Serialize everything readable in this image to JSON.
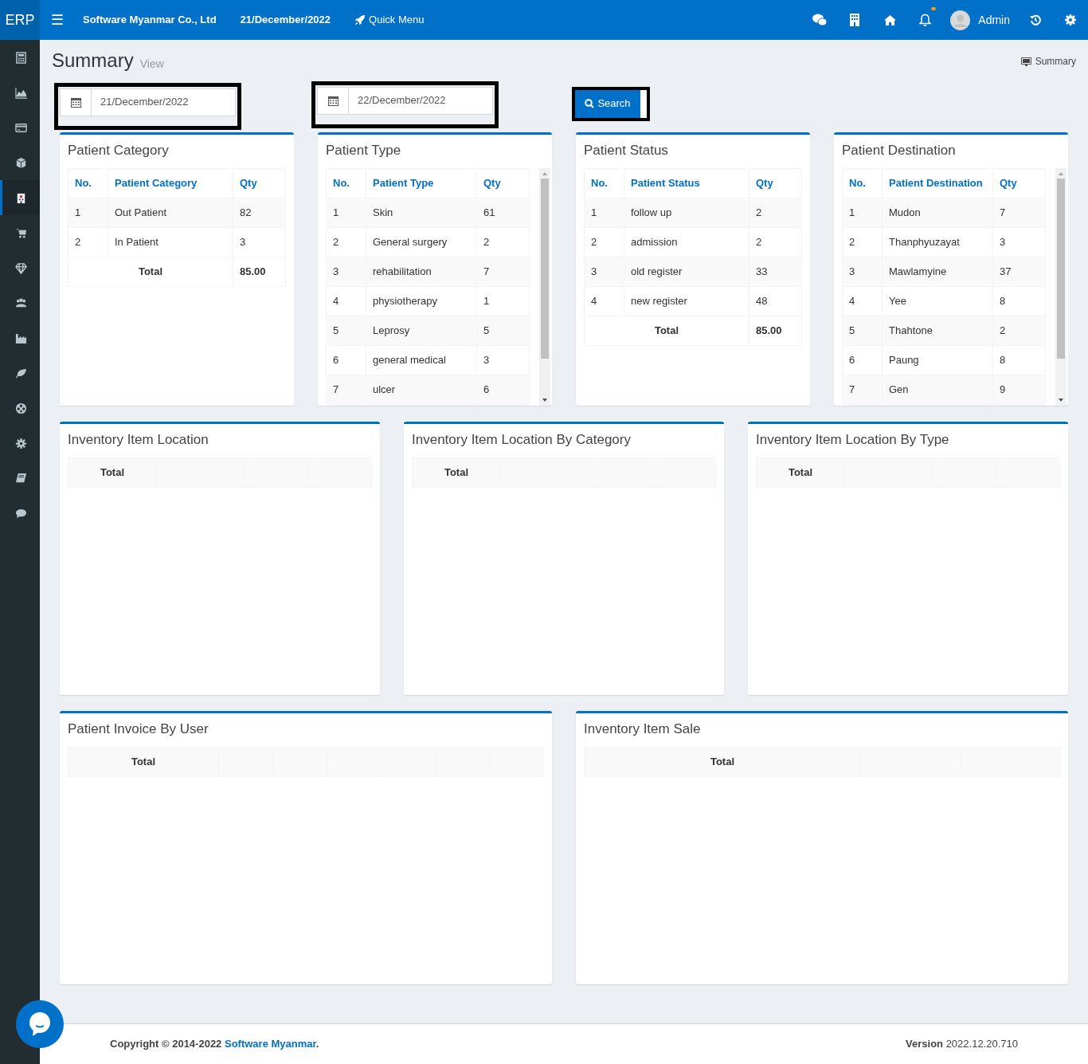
{
  "topbar": {
    "brand": "ERP",
    "menu_icon": "☰",
    "company": "Software Myanmar Co., Ltd",
    "date": "21/December/2022",
    "quick_menu": "Quick Menu",
    "has_notification": true,
    "user": "Admin"
  },
  "sidebar": {
    "items": [
      {
        "selected": false
      },
      {
        "selected": false
      },
      {
        "selected": false
      },
      {
        "selected": false
      },
      {
        "selected": true
      },
      {
        "selected": false
      },
      {
        "selected": false
      },
      {
        "selected": false
      },
      {
        "selected": false
      },
      {
        "selected": false
      },
      {
        "selected": false
      },
      {
        "selected": false
      },
      {
        "selected": false
      },
      {
        "selected": false
      }
    ]
  },
  "page_header": {
    "title": "Summary",
    "subtitle": "View",
    "breadcrumb": "Summary"
  },
  "filters": {
    "date_from": "21/December/2022",
    "date_to": "22/December/2022",
    "search_button": "Search"
  },
  "panels": [
    {
      "kind": "table",
      "title": "Patient Category",
      "scrollable": false,
      "columns": [
        "No.",
        "Patient Category",
        "Qty"
      ],
      "rows": [
        [
          "1",
          "Out Patient",
          "82"
        ],
        [
          "2",
          "In Patient",
          "3"
        ]
      ],
      "total": {
        "label": "Total",
        "value": "85.00"
      }
    },
    {
      "kind": "table",
      "title": "Patient Type",
      "scrollable": true,
      "columns": [
        "No.",
        "Patient Type",
        "Qty"
      ],
      "rows": [
        [
          "1",
          "Skin",
          "61"
        ],
        [
          "2",
          "General surgery",
          "2"
        ],
        [
          "3",
          "rehabilitation",
          "7"
        ],
        [
          "4",
          "physiotherapy",
          "1"
        ],
        [
          "5",
          "Leprosy",
          "5"
        ],
        [
          "6",
          "general medical",
          "3"
        ],
        [
          "7",
          "ulcer",
          "6"
        ]
      ]
    },
    {
      "kind": "table",
      "title": "Patient Status",
      "scrollable": false,
      "columns": [
        "No.",
        "Patient Status",
        "Qty"
      ],
      "rows": [
        [
          "1",
          "follow up",
          "2"
        ],
        [
          "2",
          "admission",
          "2"
        ],
        [
          "3",
          "old register",
          "33"
        ],
        [
          "4",
          "new register",
          "48"
        ]
      ],
      "total": {
        "label": "Total",
        "value": "85.00"
      }
    },
    {
      "kind": "table",
      "title": "Patient Destination",
      "scrollable": true,
      "columns": [
        "No.",
        "Patient Destination",
        "Qty"
      ],
      "rows": [
        [
          "1",
          "Mudon",
          "7"
        ],
        [
          "2",
          "Thanphyuzayat",
          "3"
        ],
        [
          "3",
          "Mawlamyine",
          "37"
        ],
        [
          "4",
          "Yee",
          "8"
        ],
        [
          "5",
          "Thahtone",
          "2"
        ],
        [
          "6",
          "Paung",
          "8"
        ],
        [
          "7",
          "Gen",
          "9"
        ]
      ]
    },
    {
      "kind": "empty",
      "title": "Inventory Item Location",
      "total_label": "Total"
    },
    {
      "kind": "empty",
      "title": "Inventory Item Location By Category",
      "total_label": "Total"
    },
    {
      "kind": "empty",
      "title": "Inventory Item Location By Type",
      "total_label": "Total"
    },
    {
      "kind": "empty",
      "title": "Patient Invoice By User",
      "total_label": "Total"
    },
    {
      "kind": "empty",
      "title": "Inventory Item Sale",
      "total_label": "Total"
    }
  ],
  "footer": {
    "copyright": "Copyright © 2014-2022",
    "company_link": "Software Myanmar",
    "period": ".",
    "version_label": "Version",
    "version": "2022.12.20.710"
  }
}
